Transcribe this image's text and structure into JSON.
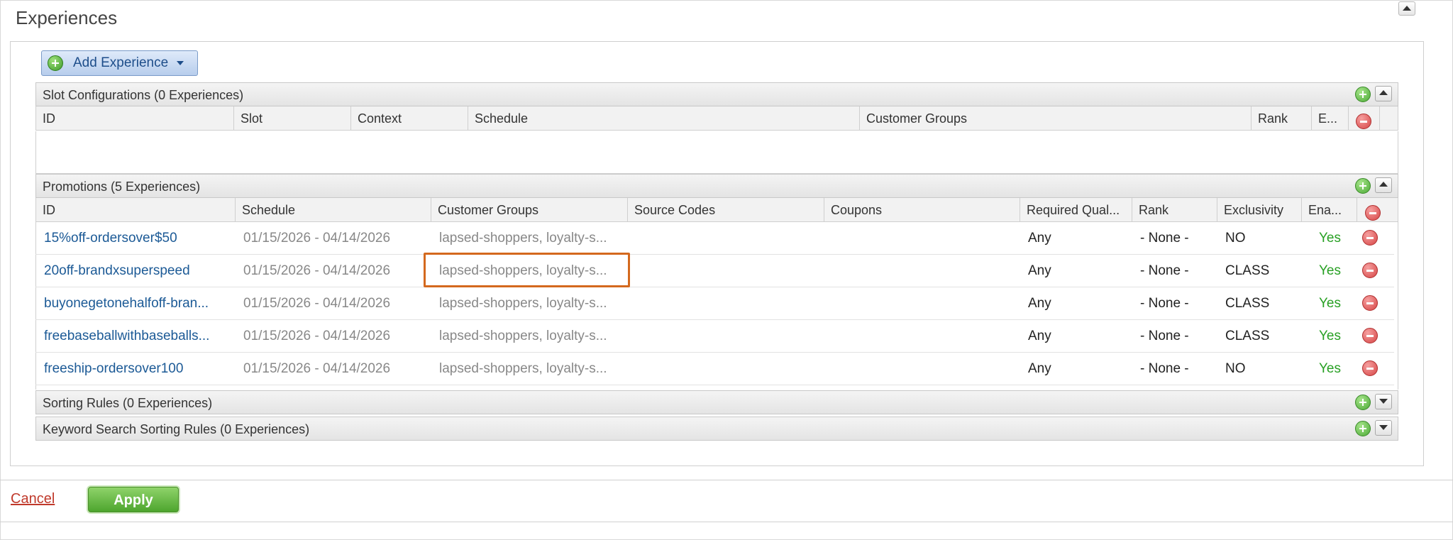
{
  "page": {
    "title": "Experiences"
  },
  "toolbar": {
    "add_label": "Add Experience"
  },
  "slot_configurations": {
    "title": "Slot Configurations (0 Experiences)",
    "columns": [
      "ID",
      "Slot",
      "Context",
      "Schedule",
      "Customer Groups",
      "Rank",
      "E..."
    ]
  },
  "promotions": {
    "title": "Promotions (5 Experiences)",
    "columns": [
      "ID",
      "Schedule",
      "Customer Groups",
      "Source Codes",
      "Coupons",
      "Required Qual...",
      "Rank",
      "Exclusivity",
      "Ena..."
    ],
    "rows": [
      {
        "id": "15%off-ordersover$50",
        "schedule": "01/15/2026 - 04/14/2026",
        "groups_a": "lapsed-shoppers",
        "groups_b": "loyalty-s...",
        "source_codes": "",
        "coupons": "",
        "required": "Any",
        "rank": "- None -",
        "exclusivity": "NO",
        "enabled": "Yes"
      },
      {
        "id": "20off-brandxsuperspeed",
        "schedule": "01/15/2026 - 04/14/2026",
        "groups_a": "lapsed-shoppers",
        "groups_b": "loyalty-s...",
        "source_codes": "",
        "coupons": "",
        "required": "Any",
        "rank": "- None -",
        "exclusivity": "CLASS",
        "enabled": "Yes"
      },
      {
        "id": "buyonegetonehalfoff-bran...",
        "schedule": "01/15/2026 - 04/14/2026",
        "groups_a": "lapsed-shoppers",
        "groups_b": "loyalty-s...",
        "source_codes": "",
        "coupons": "",
        "required": "Any",
        "rank": "- None -",
        "exclusivity": "CLASS",
        "enabled": "Yes"
      },
      {
        "id": "freebaseballwithbaseballs...",
        "schedule": "01/15/2026 - 04/14/2026",
        "groups_a": "lapsed-shoppers",
        "groups_b": "loyalty-s...",
        "source_codes": "",
        "coupons": "",
        "required": "Any",
        "rank": "- None -",
        "exclusivity": "CLASS",
        "enabled": "Yes"
      },
      {
        "id": "freeship-ordersover100",
        "schedule": "01/15/2026 - 04/14/2026",
        "groups_a": "lapsed-shoppers",
        "groups_b": "loyalty-s...",
        "source_codes": "",
        "coupons": "",
        "required": "Any",
        "rank": "- None -",
        "exclusivity": "NO",
        "enabled": "Yes"
      }
    ]
  },
  "sorting_rules": {
    "title": "Sorting Rules (0 Experiences)"
  },
  "keyword_sorting_rules": {
    "title": "Keyword Search Sorting Rules (0 Experiences)"
  },
  "footer": {
    "cancel_label": "Cancel",
    "apply_label": "Apply"
  },
  "colors": {
    "link": "#1c5a96",
    "enabled_yes": "#28a024",
    "highlight": "#d4691e",
    "apply_green": "#4da52e",
    "cancel_red": "#c0392b"
  },
  "icons": [
    "plus-circle-icon",
    "minus-circle-icon",
    "collapse-up-icon",
    "expand-down-icon",
    "caret-down-icon"
  ]
}
